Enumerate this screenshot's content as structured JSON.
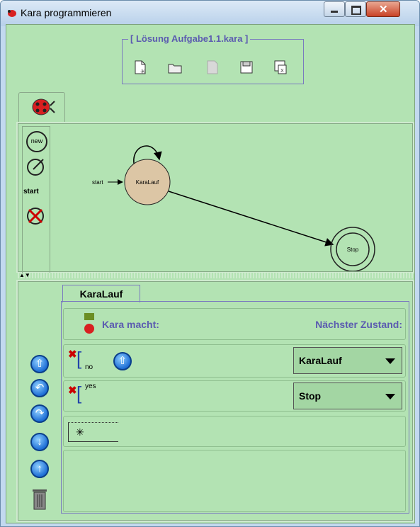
{
  "window": {
    "title": "Kara programmieren"
  },
  "file_box": {
    "title": "[ Lösung Aufgabe1.1.kara ]"
  },
  "graph": {
    "start_label": "start",
    "states": [
      {
        "id": "karalauf",
        "label": "KaraLauf"
      },
      {
        "id": "stop",
        "label": "Stop"
      }
    ]
  },
  "tools": {
    "start_label": "start"
  },
  "state_tab": {
    "label": "KaraLauf"
  },
  "header": {
    "kara_macht": "Kara macht:",
    "naechster_zustand": "Nächster Zustand:"
  },
  "rows": [
    {
      "sensor_label": "no",
      "action_icon": "up-arrow-icon",
      "next_state": "KaraLauf"
    },
    {
      "sensor_label": "yes",
      "next_state": "Stop"
    }
  ],
  "colors": {
    "background": "#b3e3b3",
    "state_fill": "#dcc6a5",
    "accent_blue": "#1e6fd6",
    "delete_red": "#cc0000"
  }
}
